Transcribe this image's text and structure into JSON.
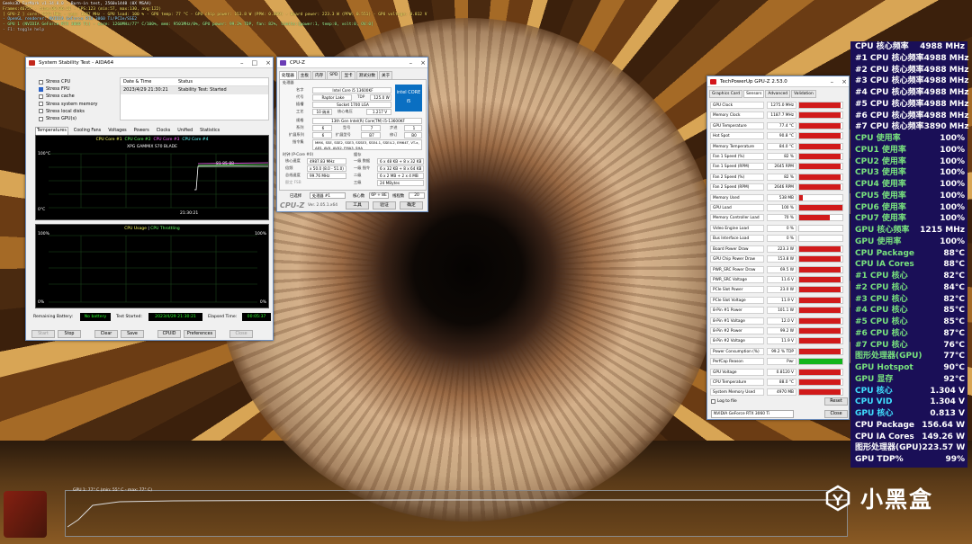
{
  "furmark": {
    "line1": "Geeks3D FurMark v1.34.0.0 - Burn-in test, 2560x1440 (0X MSAA)",
    "line2": "Frames:46757 - time:00:06:21 - FPS:123 (min:57, max:130, avg:122)",
    "line3": "[ GPU-Z ] core: 1275 MHz - mem: 1187 MHz - GPU load: 100 % - GPU temp: 77 °C - GPU chip power: 153.8 W (PPW: 0.809) - Board power: 223.3 W (PPW: 0.551) - GPU voltage: 0.812 V",
    "line4": "- OpenGL renderer: NVIDIA GeForce RTX 3060 Ti/PCIe/SSE2",
    "line5": "- GPU 1 (NVIDIA GeForce RTX 3060 Ti) - core: 1260MHz/77° C/100%, mem: 9501MHz/0%, GPU power: 99.2% TDP, fan: 82%, limits:[power:1, temp:0, volt:0, OV:0]",
    "line6": "- F1: toggle help",
    "graph_label": "GPU 1: 77° C (min: 55° C - max: 77° C)"
  },
  "aida": {
    "title": "System Stability Test - AIDA64",
    "options": [
      {
        "label": "Stress CPU",
        "checked": false
      },
      {
        "label": "Stress FPU",
        "checked": true
      },
      {
        "label": "Stress cache",
        "checked": false
      },
      {
        "label": "Stress system memory",
        "checked": false
      },
      {
        "label": "Stress local disks",
        "checked": false
      },
      {
        "label": "Stress GPU(s)",
        "checked": false
      }
    ],
    "status_headers": [
      "Date & Time",
      "Status"
    ],
    "status_row": [
      "2023/4/29 21:30:21",
      "Stability Test: Started"
    ],
    "tabs": [
      "Temperatures",
      "Cooling Fans",
      "Voltages",
      "Powers",
      "Clocks",
      "Unified",
      "Statistics"
    ],
    "graph1_legend": [
      "CPU Core #1",
      "CPU Core #2",
      "CPU Core #3",
      "CPU Core #4"
    ],
    "graph1_legend2": "XPG GAMMIX S70 BLADE",
    "graph1_top": "100°C",
    "graph1_bottom": "0°C",
    "graph1_time": "21:30:21",
    "graph1_values": "81 85 88",
    "graph2_title": "CPU Usage",
    "graph2_title2": "CPU Throttling",
    "graph2_top_left": "100%",
    "graph2_top_right": "100%",
    "graph2_bottom_left": "0%",
    "graph2_bottom_right": "0%",
    "remaining_battery_label": "Remaining Battery:",
    "remaining_battery_value": "No battery",
    "test_started_label": "Test Started:",
    "test_started_value": "2023/4/29 21:30:21",
    "elapsed_label": "Elapsed Time:",
    "elapsed_value": "00:05:37",
    "buttons": [
      "Start",
      "Stop",
      "Clear",
      "Save",
      "CPUID",
      "Preferences",
      "Close"
    ]
  },
  "cpuz": {
    "title": "CPU-Z",
    "tabs": [
      "处理器",
      "主板",
      "内存",
      "SPD",
      "显卡",
      "测试分数",
      "关于"
    ],
    "group": "处理器",
    "name_label": "名字",
    "name": "Intel Core i5 13600KF",
    "code_label": "代号",
    "code": "Raptor Lake",
    "tdp_label": "TDP",
    "tdp": "125.0 W",
    "socket_label": "插槽",
    "socket": "Socket 1700 LGA",
    "tech_label": "工艺",
    "tech": "10 纳米",
    "voltage_label": "核心电压",
    "voltage": "1.217 V",
    "spec_label": "规格",
    "spec": "13th Gen Intel(R) Core(TM) i5-13600KF",
    "family_label": "系列",
    "family": "6",
    "model_label": "型号",
    "model": "7",
    "stepping_label": "步进",
    "stepping": "1",
    "extfamily_label": "扩展系列",
    "extfamily": "6",
    "extmodel_label": "扩展型号",
    "extmodel": "B7",
    "revision_label": "修订",
    "revision": "B0",
    "instr_label": "指令集",
    "instr": "MMX, SSE, SSE2, SSE3, SSSE3, SSE4.1, SSE4.2, EM64T, VT-x, AES, AVX, AVX2, FMA3, SHA",
    "clocks_group": "时钟 (P-Core #0)",
    "core_speed_label": "核心速度",
    "core_speed": "4987.83 MHz",
    "mult_label": "倍频",
    "mult": "x 50.0 (8.0 - 51.0)",
    "bus_label": "总线速度",
    "bus": "99.76 MHz",
    "fsb_label": "额定 FSB",
    "cache_group": "缓存",
    "l1d_label": "一级 数据",
    "l1d": "6 x 48 KB + 8 x 32 KB",
    "l1i_label": "一级 指令",
    "l1i": "6 x 32 KB + 8 x 64 KB",
    "l2_label": "二级",
    "l2": "6 x 2 MB + 2 x 4 MB",
    "l3_label": "三级",
    "l3": "24 MBytes",
    "selected_label": "已选择",
    "selected": "处理器 #1",
    "cores_label": "核心数",
    "cores": "6P + 8E",
    "threads_label": "线程数",
    "threads": "20",
    "intel_badge": "intel CORE i5",
    "version": "Ver. 2.05.1.x64",
    "tools_btn": "工具",
    "validate_btn": "验证",
    "ok_btn": "确定",
    "logo": "CPU-Z"
  },
  "gpuz": {
    "title": "TechPowerUp GPU-Z 2.53.0",
    "tabs": [
      "Graphics Card",
      "Sensors",
      "Advanced",
      "Validation"
    ],
    "rows": [
      {
        "name": "GPU Clock",
        "value": "1275.0 MHz",
        "fill": 0.95,
        "color": "red"
      },
      {
        "name": "Memory Clock",
        "value": "1187.7 MHz",
        "fill": 0.95,
        "color": "red"
      },
      {
        "name": "GPU Temperature",
        "value": "77.4 °C",
        "fill": 0.95,
        "color": "red"
      },
      {
        "name": "Hot Spot",
        "value": "90.8 °C",
        "fill": 0.95,
        "color": "red"
      },
      {
        "name": "Memory Temperature",
        "value": "84.0 °C",
        "fill": 0.95,
        "color": "red"
      },
      {
        "name": "Fan 1 Speed (%)",
        "value": "82 %",
        "fill": 0.95,
        "color": "red"
      },
      {
        "name": "Fan 1 Speed (RPM)",
        "value": "2645 RPM",
        "fill": 0.95,
        "color": "red"
      },
      {
        "name": "Fan 2 Speed (%)",
        "value": "82 %",
        "fill": 0.95,
        "color": "red"
      },
      {
        "name": "Fan 2 Speed (RPM)",
        "value": "2646 RPM",
        "fill": 0.95,
        "color": "red"
      },
      {
        "name": "Memory Used",
        "value": "538 MB",
        "fill": 0.08,
        "color": "red"
      },
      {
        "name": "GPU Load",
        "value": "100 %",
        "fill": 1.0,
        "color": "red"
      },
      {
        "name": "Memory Controller Load",
        "value": "70 %",
        "fill": 0.7,
        "color": "red"
      },
      {
        "name": "Video Engine Load",
        "value": "0 %",
        "fill": 0,
        "color": "red"
      },
      {
        "name": "Bus Interface Load",
        "value": "0 %",
        "fill": 0,
        "color": "red"
      },
      {
        "name": "Board Power Draw",
        "value": "223.3 W",
        "fill": 0.95,
        "color": "red"
      },
      {
        "name": "GPU Chip Power Draw",
        "value": "153.8 W",
        "fill": 0.95,
        "color": "red"
      },
      {
        "name": "PWR_SRC Power Draw",
        "value": "69.5 W",
        "fill": 0.95,
        "color": "red"
      },
      {
        "name": "PWR_SRC Voltage",
        "value": "11.6 V",
        "fill": 0.95,
        "color": "red"
      },
      {
        "name": "PCIe Slot Power",
        "value": "23.0 W",
        "fill": 0.95,
        "color": "red"
      },
      {
        "name": "PCIe Slot Voltage",
        "value": "11.9 V",
        "fill": 0.95,
        "color": "red"
      },
      {
        "name": "8-Pin #1 Power",
        "value": "101.1 W",
        "fill": 0.95,
        "color": "red"
      },
      {
        "name": "8-Pin #1 Voltage",
        "value": "12.0 V",
        "fill": 0.95,
        "color": "red"
      },
      {
        "name": "8-Pin #2 Power",
        "value": "99.2 W",
        "fill": 0.95,
        "color": "red"
      },
      {
        "name": "8-Pin #2 Voltage",
        "value": "11.9 V",
        "fill": 0.95,
        "color": "red"
      },
      {
        "name": "Power Consumption (%)",
        "value": "99.2 % TDP",
        "fill": 0.95,
        "color": "red"
      },
      {
        "name": "PerfCap Reason",
        "value": "Pwr",
        "fill": 1.0,
        "color": "green"
      },
      {
        "name": "GPU Voltage",
        "value": "0.8120 V",
        "fill": 0.95,
        "color": "red"
      },
      {
        "name": "CPU Temperature",
        "value": "88.0 °C",
        "fill": 0.95,
        "color": "red"
      },
      {
        "name": "System Memory Used",
        "value": "4970 MB",
        "fill": 0.95,
        "color": "red"
      }
    ],
    "log_label": "Log to file",
    "reset_btn": "Reset",
    "card": "NVIDIA GeForce RTX 3060 Ti",
    "close_btn": "Close"
  },
  "sensors": [
    {
      "k": "CPU 核心频率",
      "v": "4988 MHz",
      "kc": "white"
    },
    {
      "k": "#1 CPU 核心频率",
      "v": "4988 MHz",
      "kc": "white"
    },
    {
      "k": "#2 CPU 核心频率",
      "v": "4988 MHz",
      "kc": "white"
    },
    {
      "k": "#3 CPU 核心频率",
      "v": "4988 MHz",
      "kc": "white"
    },
    {
      "k": "#4 CPU 核心频率",
      "v": "4988 MHz",
      "kc": "white"
    },
    {
      "k": "#5 CPU 核心频率",
      "v": "4988 MHz",
      "kc": "white"
    },
    {
      "k": "#6 CPU 核心频率",
      "v": "4988 MHz",
      "kc": "white"
    },
    {
      "k": "#7 CPU 核心频率",
      "v": "3890 MHz",
      "kc": "white"
    },
    {
      "k": "CPU 使用率",
      "v": "100%",
      "kc": "green"
    },
    {
      "k": "CPU1 使用率",
      "v": "100%",
      "kc": "green"
    },
    {
      "k": "CPU2 使用率",
      "v": "100%",
      "kc": "green"
    },
    {
      "k": "CPU3 使用率",
      "v": "100%",
      "kc": "green"
    },
    {
      "k": "CPU4 使用率",
      "v": "100%",
      "kc": "green"
    },
    {
      "k": "CPU5 使用率",
      "v": "100%",
      "kc": "green"
    },
    {
      "k": "CPU6 使用率",
      "v": "100%",
      "kc": "green"
    },
    {
      "k": "CPU7 使用率",
      "v": "100%",
      "kc": "green"
    },
    {
      "k": "GPU 核心频率",
      "v": "1215 MHz",
      "kc": "green"
    },
    {
      "k": "GPU 使用率",
      "v": "100%",
      "kc": "green"
    },
    {
      "k": "CPU Package",
      "v": "88°C",
      "kc": "green"
    },
    {
      "k": "CPU IA Cores",
      "v": "88°C",
      "kc": "green"
    },
    {
      "k": "#1 CPU 核心",
      "v": "82°C",
      "kc": "green"
    },
    {
      "k": "#2 CPU 核心",
      "v": "84°C",
      "kc": "green"
    },
    {
      "k": "#3 CPU 核心",
      "v": "82°C",
      "kc": "green"
    },
    {
      "k": "#4 CPU 核心",
      "v": "85°C",
      "kc": "green"
    },
    {
      "k": "#5 CPU 核心",
      "v": "85°C",
      "kc": "green"
    },
    {
      "k": "#6 CPU 核心",
      "v": "87°C",
      "kc": "green"
    },
    {
      "k": "#7 CPU 核心",
      "v": "76°C",
      "kc": "green"
    },
    {
      "k": "图形处理器(GPU)",
      "v": "77°C",
      "kc": "green"
    },
    {
      "k": "GPU Hotspot",
      "v": "90°C",
      "kc": "green"
    },
    {
      "k": "GPU 显存",
      "v": "92°C",
      "kc": "green"
    },
    {
      "k": "CPU 核心",
      "v": "1.304 V",
      "kc": "cyan"
    },
    {
      "k": "CPU VID",
      "v": "1.304 V",
      "kc": "cyan"
    },
    {
      "k": "GPU 核心",
      "v": "0.813 V",
      "kc": "cyan"
    },
    {
      "k": "CPU Package",
      "v": "156.64 W",
      "kc": "white"
    },
    {
      "k": "CPU IA Cores",
      "v": "149.26 W",
      "kc": "white"
    },
    {
      "k": "图形处理器(GPU)",
      "v": "223.57 W",
      "kc": "white"
    },
    {
      "k": "GPU TDP%",
      "v": "99%",
      "kc": "white"
    }
  ],
  "watermark": "小黑盒"
}
